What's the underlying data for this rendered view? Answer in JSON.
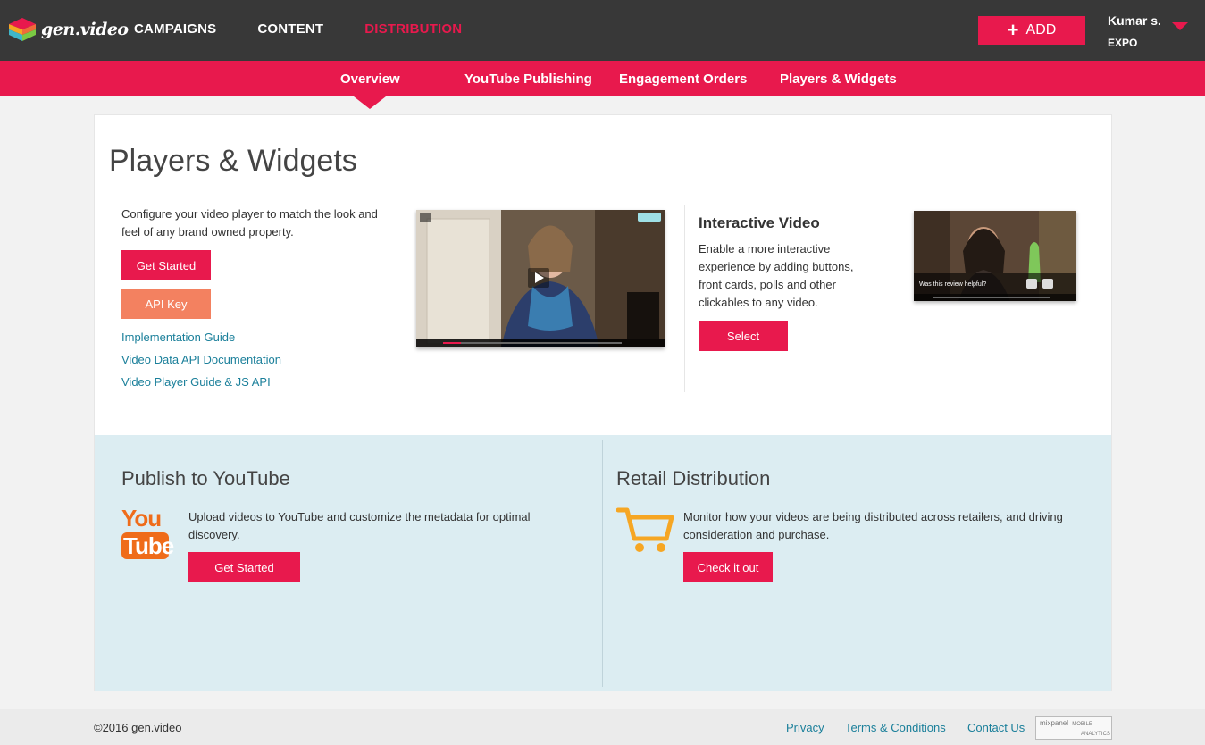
{
  "header": {
    "logo_text": "gen.video",
    "nav": [
      "CAMPAIGNS",
      "CONTENT",
      "DISTRIBUTION"
    ],
    "nav_active": "DISTRIBUTION",
    "add_label": "ADD",
    "user_name": "Kumar s.",
    "user_org": "EXPO"
  },
  "subnav": {
    "items": [
      "Overview",
      "YouTube Publishing",
      "Engagement Orders",
      "Players & Widgets"
    ],
    "active": "Overview"
  },
  "main": {
    "title": "Players & Widgets",
    "player": {
      "description": "Configure your video player to match the look and feel of any brand owned property.",
      "get_started_label": "Get Started",
      "api_key_label": "API Key",
      "links": [
        "Implementation Guide",
        "Video Data API Documentation",
        "Video Player Guide & JS API"
      ]
    },
    "interactive": {
      "heading": "Interactive Video",
      "description": "Enable a more interactive experience by adding buttons, front cards, polls and other clickables to any video.",
      "select_label": "Select",
      "overlay_text": "Was this review helpful?"
    },
    "youtube": {
      "heading": "Publish to YouTube",
      "logo_top": "You",
      "logo_bottom": "Tube",
      "description": "Upload videos to YouTube and customize the metadata for optimal discovery.",
      "button_label": "Get Started"
    },
    "retail": {
      "heading": "Retail Distribution",
      "description": "Monitor how your videos are being distributed across retailers, and driving consideration and purchase.",
      "button_label": "Check it out"
    }
  },
  "footer": {
    "copyright": "©2016 gen.video",
    "links": [
      "Privacy",
      "Terms & Conditions",
      "Contact Us"
    ],
    "badge_line1": "mixpanel",
    "badge_line2": "MOBILE",
    "badge_line3": "ANALYTICS"
  },
  "colors": {
    "accent": "#e8194d",
    "orange": "#f38160",
    "topbar": "#383838",
    "band": "#dcedf2",
    "link": "#1a7f9a"
  }
}
